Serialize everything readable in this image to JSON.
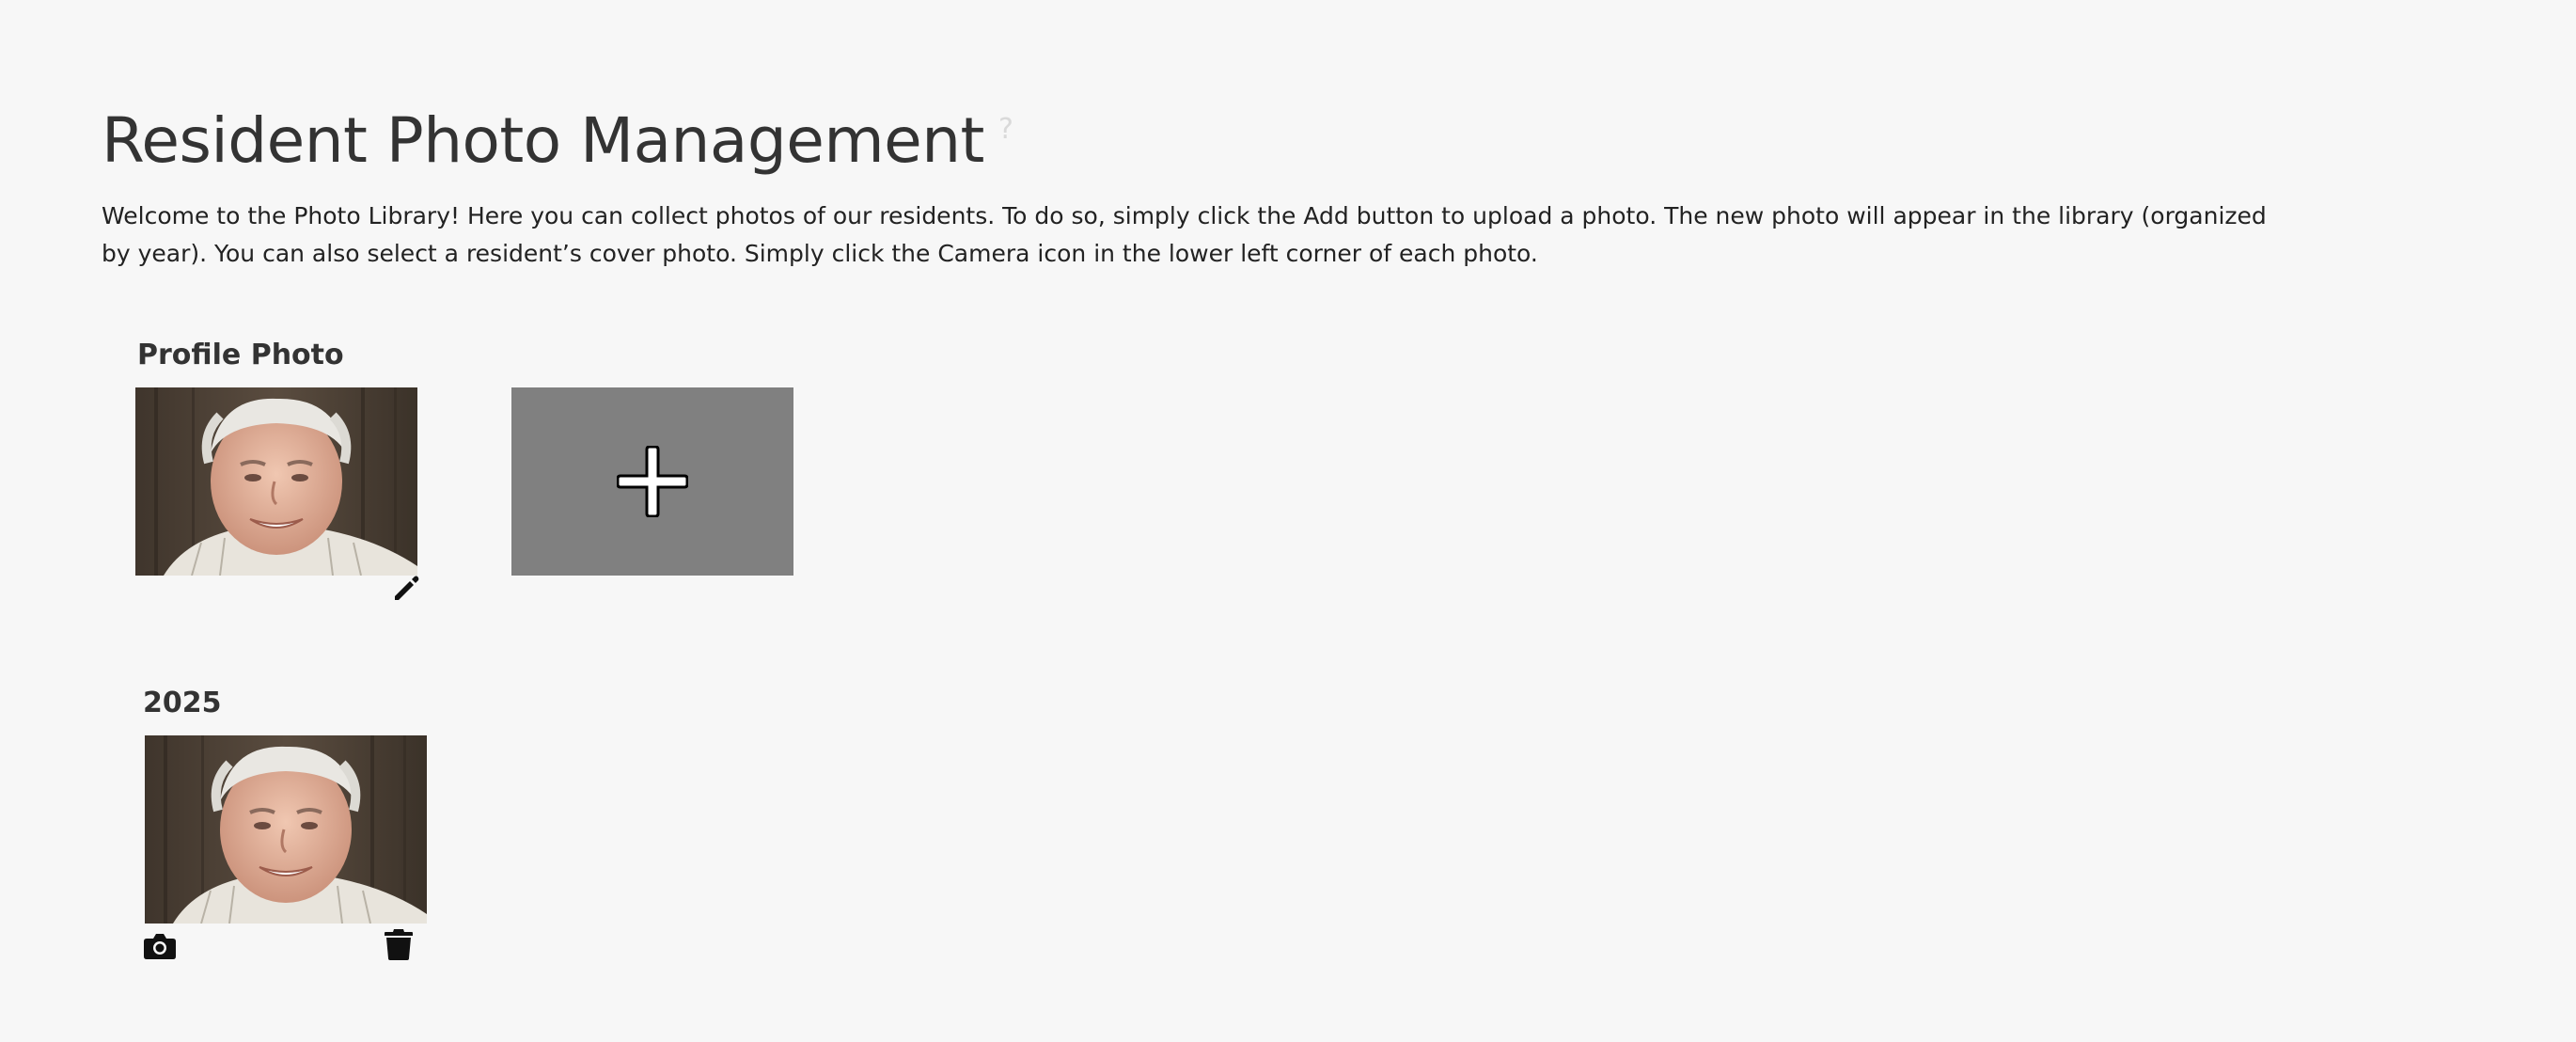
{
  "page": {
    "title": "Resident Photo Management",
    "help_glyph": "?",
    "intro": "Welcome to the Photo Library! Here you can collect photos of our residents. To do so, simply click the Add button to upload a photo. The new photo will appear in the library (organized by year). You can also select a resident’s cover photo. Simply click the Camera icon in the lower left corner of each photo."
  },
  "profile": {
    "label": "Profile Photo",
    "photo_alt": "Resident profile photo",
    "edit_icon": "pencil-icon"
  },
  "add_button": {
    "icon": "plus-icon",
    "aria_label": "Add"
  },
  "library": {
    "groups": [
      {
        "year": "2025",
        "photos": [
          {
            "alt": "Resident photo",
            "cover_icon": "camera-icon",
            "delete_icon": "trash-icon"
          }
        ]
      }
    ]
  },
  "colors": {
    "background": "#f7f7f7",
    "text": "#333333",
    "add_tile": "#808080",
    "help_icon": "#d9d9d9"
  }
}
